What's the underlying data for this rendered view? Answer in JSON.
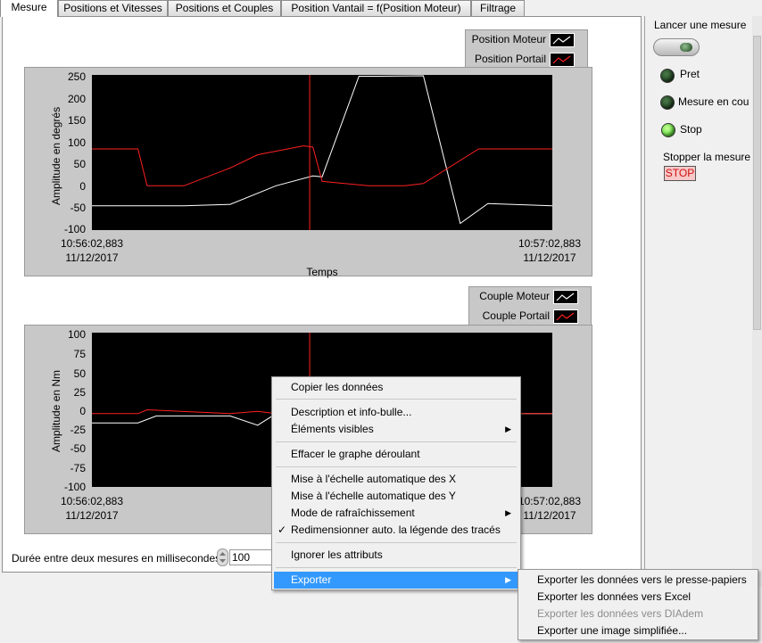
{
  "tabs": [
    "Mesure",
    "Positions et Vitesses",
    "Positions et Couples",
    "Position Vantail = f(Position Moteur)",
    "Filtrage"
  ],
  "graph1": {
    "legend": [
      "Position Moteur",
      "Position Portail"
    ],
    "y_ticks": [
      "250",
      "200",
      "150",
      "100",
      "50",
      "0",
      "-50",
      "-100"
    ],
    "ylabel": "Amplitude en degrés",
    "x_start_time": "10:56:02,883",
    "x_start_date": "11/12/2017",
    "x_end_time": "10:57:02,883",
    "x_end_date": "11/12/2017",
    "xlabel": "Temps"
  },
  "graph2": {
    "legend": [
      "Couple Moteur",
      "Couple Portail"
    ],
    "y_ticks": [
      "100",
      "75",
      "50",
      "25",
      "0",
      "-25",
      "-50",
      "-75",
      "-100"
    ],
    "ylabel": "Amplitude en Nm",
    "x_start_time": "10:56:02,883",
    "x_start_date": "11/12/2017",
    "x_end_time": "10:57:02,883",
    "x_end_date": "11/12/2017"
  },
  "right_panel": {
    "launch_label": "Lancer une mesure",
    "leds": [
      {
        "label": "Pret",
        "state": "off"
      },
      {
        "label": "Mesure en cou",
        "state": "off"
      },
      {
        "label": "Stop",
        "state": "on"
      }
    ],
    "stop_label": "Stopper la mesure",
    "stop_button": "STOP"
  },
  "bottom": {
    "interval_label": "Durée entre deux mesures en millisecondes",
    "interval_value": "100"
  },
  "context_menu": {
    "items": [
      "Copier les données",
      "Description et info-bulle...",
      "Éléments visibles",
      "Effacer le graphe déroulant",
      "Mise à l'échelle automatique des X",
      "Mise à l'échelle automatique des Y",
      "Mode de rafraîchissement",
      "Redimensionner auto. la légende des tracés",
      "Ignorer les attributs",
      "Exporter"
    ]
  },
  "submenu": {
    "items": [
      "Exporter les données vers le presse-papiers",
      "Exporter les données vers Excel",
      "Exporter les données vers DIAdem",
      "Exporter une image simplifiée..."
    ]
  },
  "colors": {
    "trace_white": "#ffffff",
    "trace_red": "#ff2020",
    "cursor": "#ff2020",
    "plot_bg": "#000000",
    "highlight": "#3399ff"
  },
  "chart_data": [
    {
      "type": "line",
      "ylabel": "Amplitude en degrés",
      "xlabel": "Temps",
      "ylim": [
        -100,
        250
      ],
      "series": [
        {
          "name": "Position Moteur",
          "x": [
            0,
            8,
            20,
            30,
            40,
            48,
            50,
            58,
            62,
            72,
            80,
            86,
            100
          ],
          "y": [
            -45,
            -45,
            -45,
            -42,
            0,
            22,
            20,
            247,
            247,
            248,
            -85,
            -40,
            -45
          ]
        },
        {
          "name": "Position Portail",
          "x": [
            0,
            10,
            12,
            20,
            30,
            36,
            46,
            48,
            50,
            60,
            68,
            72,
            84,
            100
          ],
          "y": [
            83,
            83,
            0,
            0,
            40,
            70,
            90,
            87,
            10,
            0,
            0,
            5,
            83,
            83
          ]
        }
      ]
    },
    {
      "type": "line",
      "ylabel": "Amplitude en Nm",
      "ylim": [
        -100,
        100
      ],
      "series": [
        {
          "name": "Couple Moteur",
          "x": [
            0,
            10,
            14,
            20,
            30,
            36,
            40,
            100
          ],
          "y": [
            -17,
            -17,
            -8,
            -8,
            -8,
            -20,
            -5,
            -5
          ]
        },
        {
          "name": "Couple Portail",
          "x": [
            0,
            10,
            12,
            30,
            36,
            40,
            100
          ],
          "y": [
            -5,
            -5,
            0,
            -5,
            -2,
            -5,
            -5
          ]
        }
      ]
    }
  ]
}
